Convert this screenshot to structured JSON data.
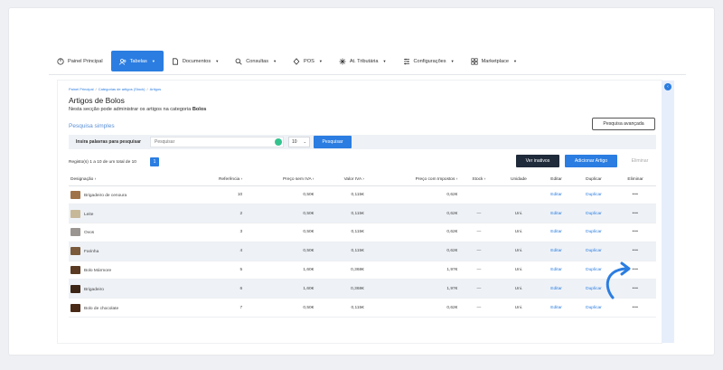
{
  "nav": {
    "items": [
      {
        "label": "Painel Principal",
        "icon": "dashboard-icon",
        "caret": false,
        "active": false
      },
      {
        "label": "Tabelas",
        "icon": "users-icon",
        "caret": true,
        "active": true
      },
      {
        "label": "Documentos",
        "icon": "document-icon",
        "caret": true,
        "active": false
      },
      {
        "label": "Consultas",
        "icon": "search-icon",
        "caret": true,
        "active": false
      },
      {
        "label": "POS",
        "icon": "pos-icon",
        "caret": true,
        "active": false
      },
      {
        "label": "At. Tributária",
        "icon": "tax-icon",
        "caret": true,
        "active": false
      },
      {
        "label": "Configurações",
        "icon": "settings-icon",
        "caret": true,
        "active": false
      },
      {
        "label": "Marketplace",
        "icon": "marketplace-icon",
        "caret": true,
        "active": false
      }
    ]
  },
  "breadcrumb": [
    "Painel Principal",
    "Categorias de artigos (Stock)",
    "Artigos"
  ],
  "page": {
    "title": "Artigos de Bolos",
    "subtitle_prefix": "Nesta secção pode administrar os artigos na categoria ",
    "subtitle_category": "Bolos",
    "simple_search_link": "Pesquisa simples",
    "advanced_search_button": "Pesquisa avançada"
  },
  "search": {
    "label": "Insira palavras para pesquisar",
    "placeholder": "Pesquisar",
    "page_size": "10",
    "button": "Pesquisar"
  },
  "records": {
    "text": "Registo(s) 1 a 10 de um total de 10",
    "current_page": "1"
  },
  "actions": {
    "inactive_button": "Ver inativos",
    "add_button": "Adicionar Artigo",
    "delete_button": "Eliminar"
  },
  "table": {
    "columns": [
      "Designação",
      "Referência",
      "Preço sem IVA",
      "Valor IVA",
      "Preço com Impostos",
      "Stock",
      "Unidade",
      "Editar",
      "Duplicar",
      "Eliminar"
    ],
    "rows": [
      {
        "name": "Brigadeiro de cenoura",
        "ref": "10",
        "price": "0,50€",
        "vat": "0,115€",
        "total": "0,62€",
        "stock": "",
        "unit": "",
        "edit": "Editar",
        "dup": "Duplicar",
        "del": "•••",
        "thumb": "#a0724a"
      },
      {
        "name": "Leite",
        "ref": "2",
        "price": "0,50€",
        "vat": "0,115€",
        "total": "0,62€",
        "stock": "—",
        "unit": "Uni.",
        "edit": "Editar",
        "dup": "Duplicar",
        "del": "•••",
        "thumb": "#c8b89a"
      },
      {
        "name": "Ovos",
        "ref": "3",
        "price": "0,50€",
        "vat": "0,115€",
        "total": "0,62€",
        "stock": "—",
        "unit": "Uni.",
        "edit": "Editar",
        "dup": "Duplicar",
        "del": "•••",
        "thumb": "#9a9590"
      },
      {
        "name": "Farinha",
        "ref": "4",
        "price": "0,50€",
        "vat": "0,115€",
        "total": "0,62€",
        "stock": "—",
        "unit": "Uni.",
        "edit": "Editar",
        "dup": "Duplicar",
        "del": "•••",
        "thumb": "#7a5a3a"
      },
      {
        "name": "Bolo Mármore",
        "ref": "5",
        "price": "1,60€",
        "vat": "0,368€",
        "total": "1,97€",
        "stock": "—",
        "unit": "Uni.",
        "edit": "Editar",
        "dup": "Duplicar",
        "del": "•••",
        "thumb": "#5a3a22"
      },
      {
        "name": "Brigadeiro",
        "ref": "6",
        "price": "1,60€",
        "vat": "0,368€",
        "total": "1,97€",
        "stock": "—",
        "unit": "Uni.",
        "edit": "Editar",
        "dup": "Duplicar",
        "del": "•••",
        "thumb": "#3d2616"
      },
      {
        "name": "Bolo de chocolate",
        "ref": "7",
        "price": "0,50€",
        "vat": "0,115€",
        "total": "0,62€",
        "stock": "—",
        "unit": "Uni.",
        "edit": "Editar",
        "dup": "Duplicar",
        "del": "•••",
        "thumb": "#4a2a16"
      }
    ]
  },
  "colors": {
    "accent": "#2b7de1",
    "dark_button": "#1f2a3a",
    "success": "#34c38f",
    "row_alt": "#eef2f7"
  }
}
